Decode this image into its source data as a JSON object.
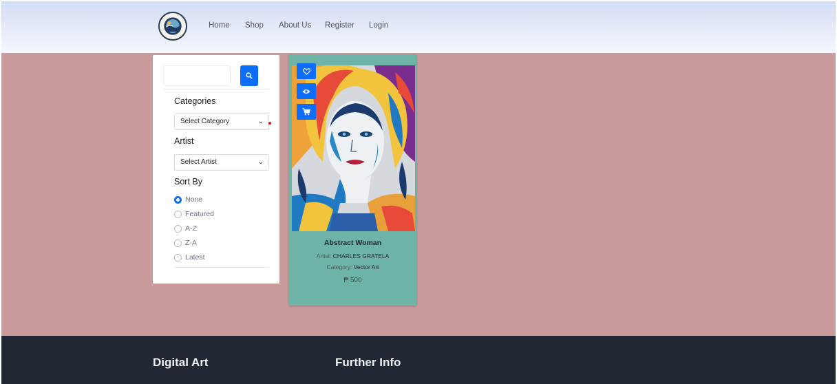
{
  "nav": {
    "home": "Home",
    "shop": "Shop",
    "about": "About Us",
    "register": "Register",
    "login": "Login"
  },
  "sidebar": {
    "search_placeholder": "",
    "categories_label": "Categories",
    "category_select": "Select Category",
    "artist_label": "Artist",
    "artist_select": "Select Artist",
    "sort_label": "Sort By",
    "sort_options": [
      {
        "label": "None",
        "checked": true
      },
      {
        "label": "Featured",
        "checked": false
      },
      {
        "label": "A-Z",
        "checked": false
      },
      {
        "label": "Z-A",
        "checked": false
      },
      {
        "label": "Latest",
        "checked": false
      }
    ]
  },
  "product": {
    "title": "Abstract Woman",
    "artist_prefix": "Artist:",
    "artist": "CHARLES GRATELA",
    "category_prefix": "Category:",
    "category": "Vector Art",
    "price": "₱ 500"
  },
  "footer": {
    "col1": "Digital Art",
    "col2": "Further Info"
  },
  "colors": {
    "accent": "#0d6efd",
    "page_bg": "#ca9b9c",
    "card_bg": "#6db4a7",
    "footer_bg": "#222833"
  },
  "icons": {
    "search": "search-icon",
    "wishlist": "heart-icon",
    "view": "eye-icon",
    "cart": "cart-icon",
    "dropdown": "chevron-down-icon"
  }
}
